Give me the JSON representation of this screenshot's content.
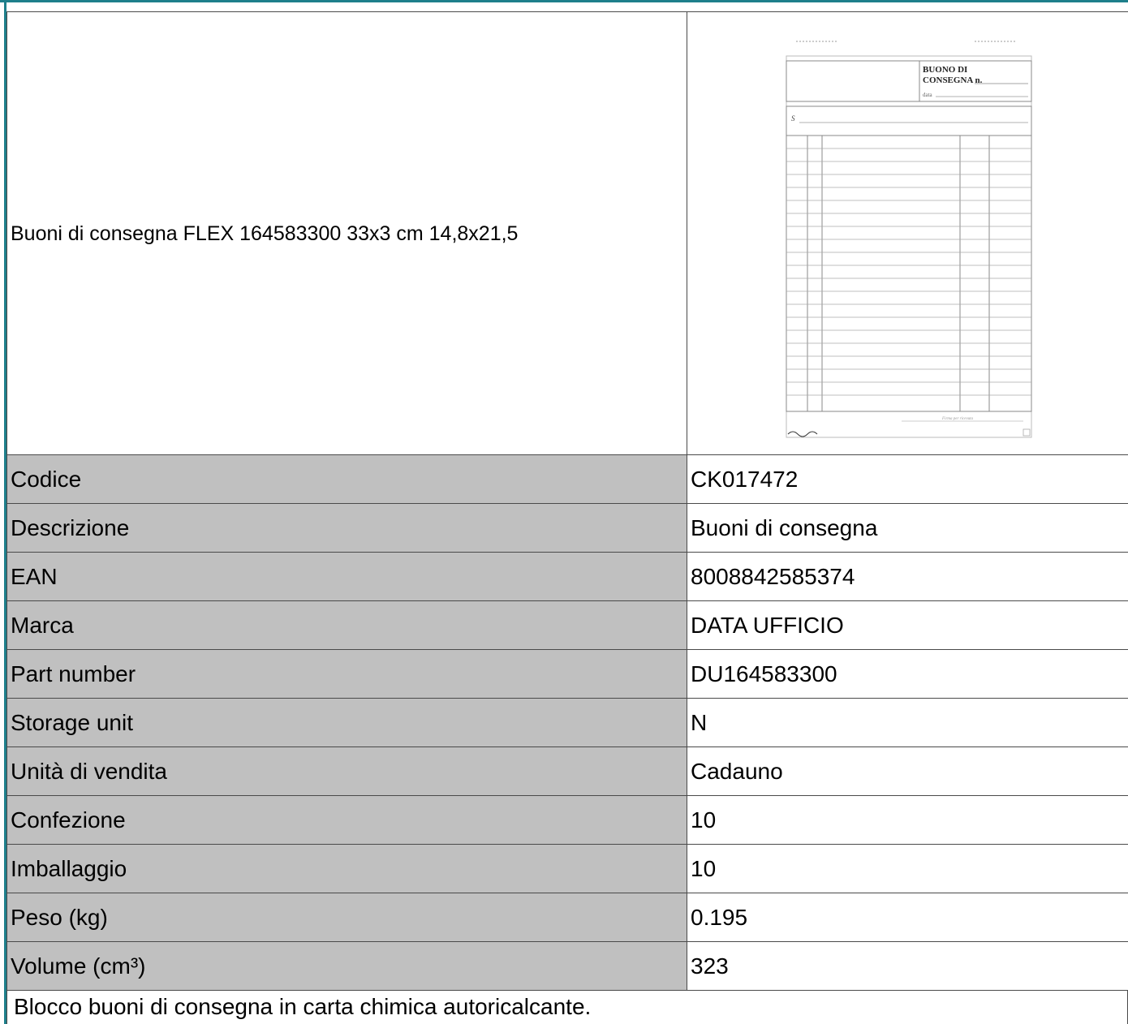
{
  "product": {
    "title": "Buoni di consegna FLEX 164583300 33x3 cm 14,8x21,5",
    "image": {
      "heading_line1": "BUONO DI",
      "heading_line2": "CONSEGNA n.",
      "date_label": "data",
      "s_label": "S",
      "signature_label": "Firma per ricevuta",
      "icon": "delivery-note-form"
    }
  },
  "specs": [
    {
      "label": "Codice",
      "value": "CK017472"
    },
    {
      "label": "Descrizione",
      "value": "Buoni di consegna"
    },
    {
      "label": "EAN",
      "value": "8008842585374"
    },
    {
      "label": "Marca",
      "value": "DATA UFFICIO"
    },
    {
      "label": "Part number",
      "value": "DU164583300"
    },
    {
      "label": "Storage unit",
      "value": "N"
    },
    {
      "label": "Unità di vendita",
      "value": "Cadauno"
    },
    {
      "label": "Confezione",
      "value": "10"
    },
    {
      "label": "Imballaggio",
      "value": "10"
    },
    {
      "label": "Peso (kg)",
      "value": "0.195"
    },
    {
      "label": "Volume (cm³)",
      "value": "323"
    }
  ],
  "description": "Blocco buoni di consegna in carta chimica autoricalcante."
}
